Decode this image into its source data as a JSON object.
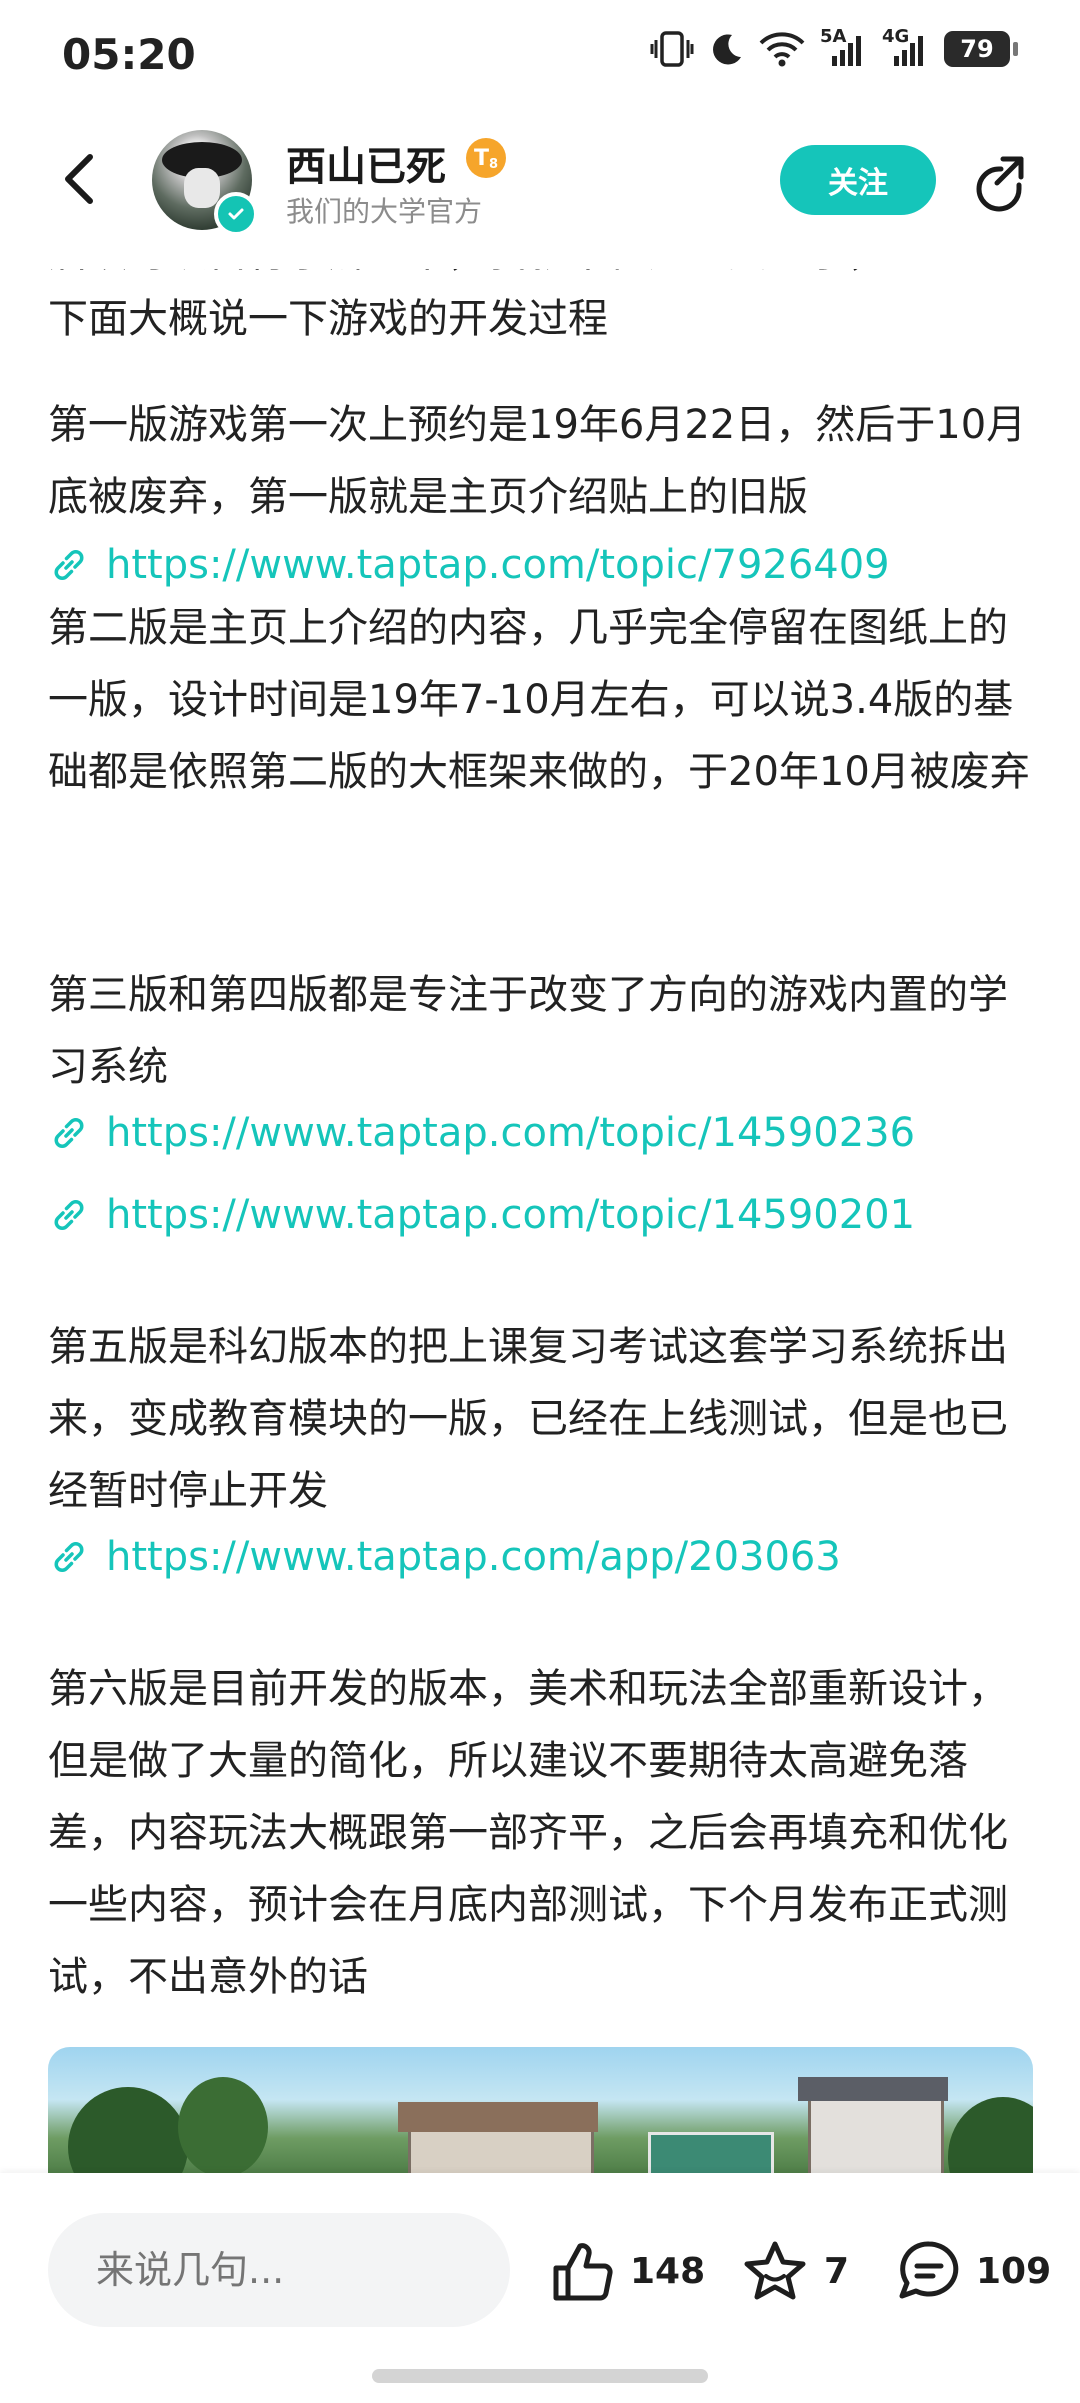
{
  "status_bar": {
    "time": "05:20",
    "net_5g": "5A",
    "net_4g": "4G",
    "battery": "79",
    "icons": [
      "vibrate-icon",
      "moon-icon",
      "wifi-icon",
      "signal-icon",
      "signal-icon",
      "battery-icon"
    ]
  },
  "header": {
    "back_icon": "chevron-left-icon",
    "author_name": "西山已死",
    "level": "T",
    "level_num": "8",
    "subtitle": "我们的大学官方",
    "follow_label": "关注",
    "share_icon": "share-icon"
  },
  "post": {
    "partial_line": "后续可以自行了解一下，我就不在这里赘述了，",
    "p1": "下面大概说一下游戏的开发过程",
    "p2": "第一版游戏第一次上预约是19年6月22日，然后于10月底被废弃，第一版就是主页介绍贴上的旧版",
    "link1": "https://www.taptap.com/topic/7926409",
    "p3": "第二版是主页上介绍的内容，几乎完全停留在图纸上的一版，设计时间是19年7-10月左右，可以说3.4版的基础都是依照第二版的大框架来做的，于20年10月被废弃",
    "p4": "第三版和第四版都是专注于改变了方向的游戏内置的学习系统",
    "link2": "https://www.taptap.com/topic/14590236",
    "link3": "https://www.taptap.com/topic/14590201",
    "p5": "第五版是科幻版本的把上课复习考试这套学习系统拆出来，变成教育模块的一版，已经在上线测试，但是也已经暂时停止开发",
    "link4": "https://www.taptap.com/app/203063",
    "p6": "第六版是目前开发的版本，美术和玩法全部重新设计，但是做了大量的简化，所以建议不要期待太高避免落差，内容玩法大概跟第一部齐平，之后会再填充和优化一些内容，预计会在月底内部测试，下个月发布正式测试，不出意外的话"
  },
  "bottom_bar": {
    "comment_placeholder": "来说几句...",
    "likes": "148",
    "favorites": "7",
    "comments": "109"
  },
  "colors": {
    "accent": "#15c5ba",
    "level_badge": "#f6a52b",
    "text": "#222222",
    "muted": "#8c8c8c"
  }
}
